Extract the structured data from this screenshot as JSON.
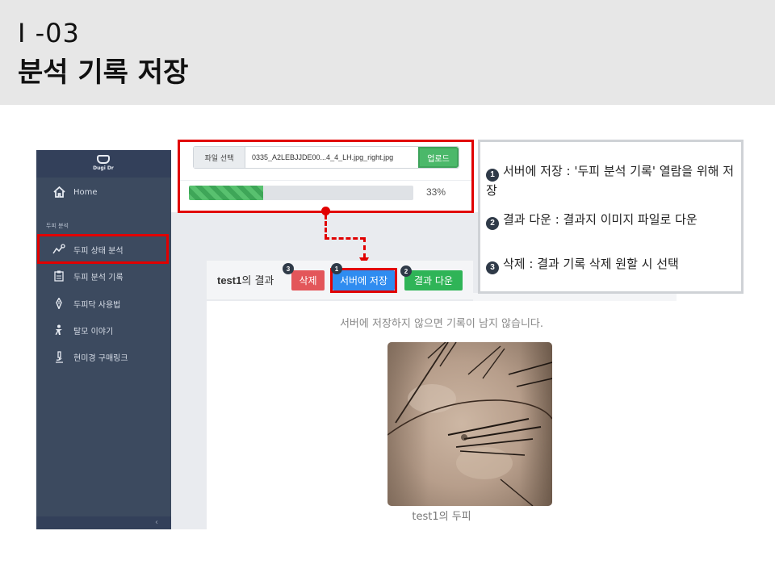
{
  "header": {
    "code": "I -03",
    "title": "분석 기록 저장"
  },
  "sidebar": {
    "logo_text": "Dugi Dr",
    "home_label": "Home",
    "section_label": "두피 분석",
    "items": [
      {
        "label": "두피 상태 분석",
        "icon": "chart-trend-icon"
      },
      {
        "label": "두피 분석 기록",
        "icon": "clipboard-icon"
      },
      {
        "label": "두피닥 사용법",
        "icon": "pen-icon"
      },
      {
        "label": "탈모 이야기",
        "icon": "person-icon"
      },
      {
        "label": "현미경 구매링크",
        "icon": "microscope-icon"
      }
    ],
    "collapse_icon": "chevron-left-icon"
  },
  "upload": {
    "file_button_label": "파일 선택",
    "file_name": "0335_A2LEBJJDE00...4_4_LH.jpg_right.jpg",
    "upload_button_label": "업로드",
    "progress_percent": 33,
    "progress_text": "33%"
  },
  "result": {
    "user": "test1",
    "title_suffix": "의 결과",
    "buttons": {
      "delete_label": "삭제",
      "save_label": "서버에 저장",
      "download_label": "결과 다운"
    },
    "badges": {
      "save": "1",
      "download": "2",
      "delete": "3"
    },
    "notice": "서버에 저장하지 않으면 기록이 남지 않습니다.",
    "caption_suffix": "의 두피"
  },
  "callout": {
    "items": [
      {
        "num": "1",
        "text": "서버에 저장 : '두피 분석 기록' 열람을 위해 저장"
      },
      {
        "num": "2",
        "text": "결과 다운 : 결과지 이미지 파일로 다운"
      },
      {
        "num": "3",
        "text": "삭제 : 결과 기록 삭제 원할 시 선택"
      }
    ]
  },
  "colors": {
    "highlight": "#e10000",
    "sidebar_bg": "#3c4a5f",
    "save_btn": "#2f8cf0",
    "download_btn": "#2fb457",
    "delete_btn": "#e3565a",
    "progress": "#58c16f"
  }
}
